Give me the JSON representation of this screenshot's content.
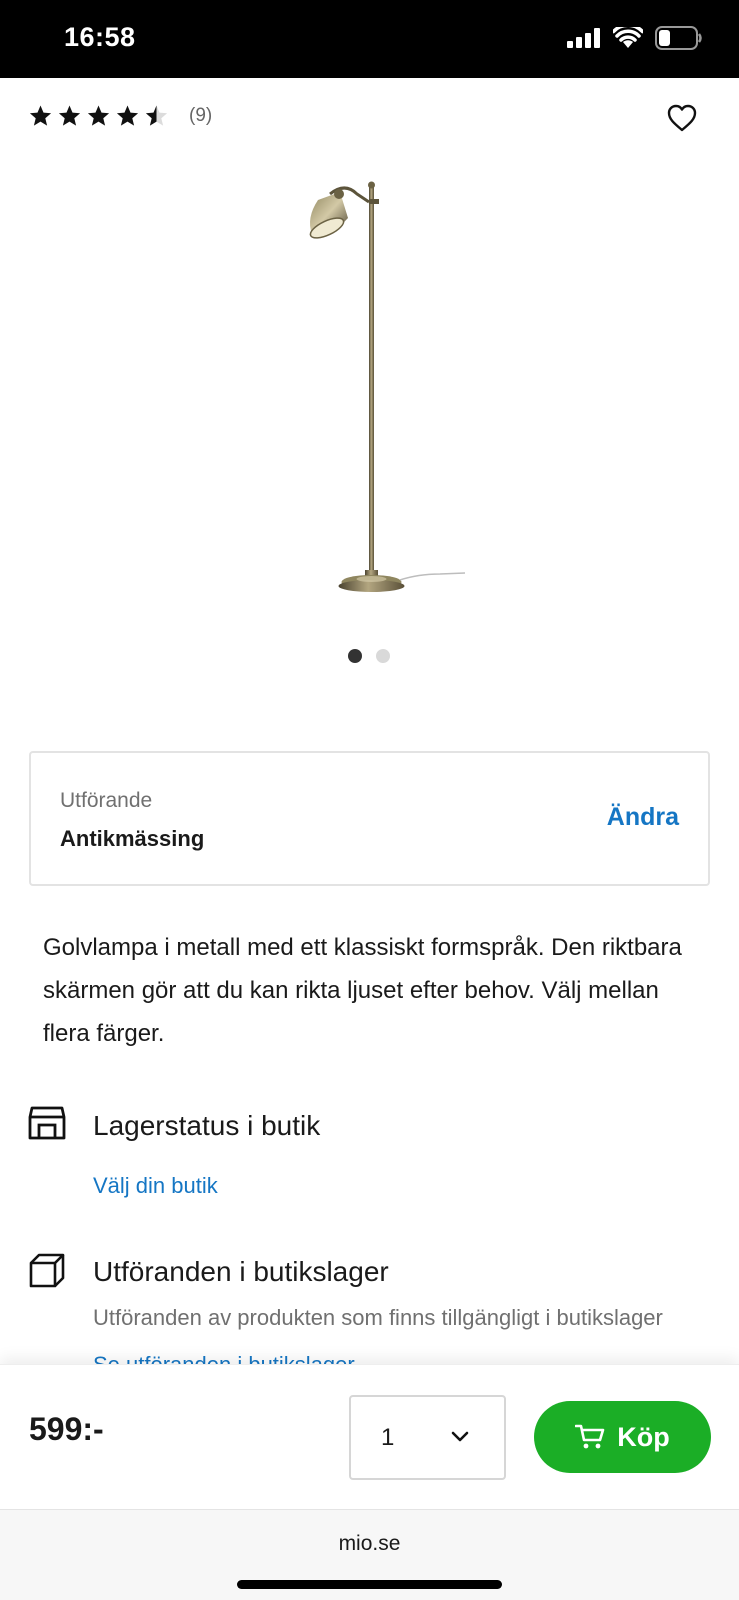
{
  "status_bar": {
    "time": "16:58",
    "icons": [
      "cellular-signal-icon",
      "wifi-icon",
      "battery-icon"
    ]
  },
  "product": {
    "rating": 4.5,
    "rating_max": 5,
    "rating_count": "(9)",
    "image_icon": "floor-lamp-image",
    "carousel": {
      "total": 2,
      "active": 1
    },
    "variant": {
      "label": "Utförande",
      "value": "Antikmässing",
      "change_label": "Ändra"
    },
    "description": "Golvlampa i metall med ett klassiskt formspråk. Den riktbara skärmen gör att du kan rikta ljuset efter behov. Välj mellan flera färger."
  },
  "stock": {
    "title": "Lagerstatus i butik",
    "link": "Välj din butik"
  },
  "variants_in_store": {
    "title": "Utföranden i butikslager",
    "description": "Utföranden av produkten som finns tillgängligt i butikslager",
    "link": "Se utföranden i butikslager"
  },
  "buy_bar": {
    "price": "599:-",
    "quantity": "1",
    "buy_label": "Köp"
  },
  "browser": {
    "url": "mio.se"
  },
  "colors": {
    "accent_blue": "#1576c4",
    "buy_green": "#1bae26",
    "text": "#1a1a1a",
    "muted": "#707070"
  }
}
